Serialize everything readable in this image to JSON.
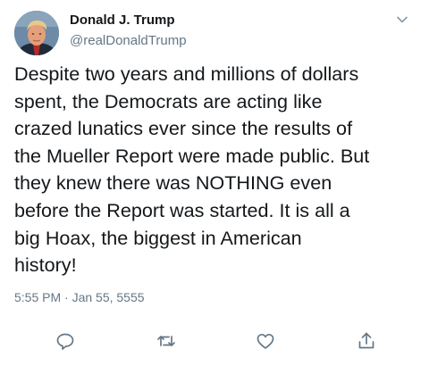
{
  "tweet": {
    "author_name": "Donald J. Trump",
    "author_handle": "@realDonaldTrump",
    "text": "Despite two years and millions of dollars\nspent, the Democrats are acting like\ncrazed lunatics ever since the results of\nthe Mueller Report were made public. But\nthey knew there was NOTHING even\nbefore the Report was started. It is all a\nbig Hoax, the biggest in American\nhistory!",
    "timestamp": "5:55 PM · Jan 55, 5555"
  },
  "icons": {
    "menu": "chevron-down-icon",
    "reply": "comment-icon",
    "retweet": "retweet-icon",
    "like": "heart-icon",
    "share": "share-icon"
  },
  "colors": {
    "text": "#14171a",
    "secondary": "#657786",
    "icon": "#657786"
  }
}
